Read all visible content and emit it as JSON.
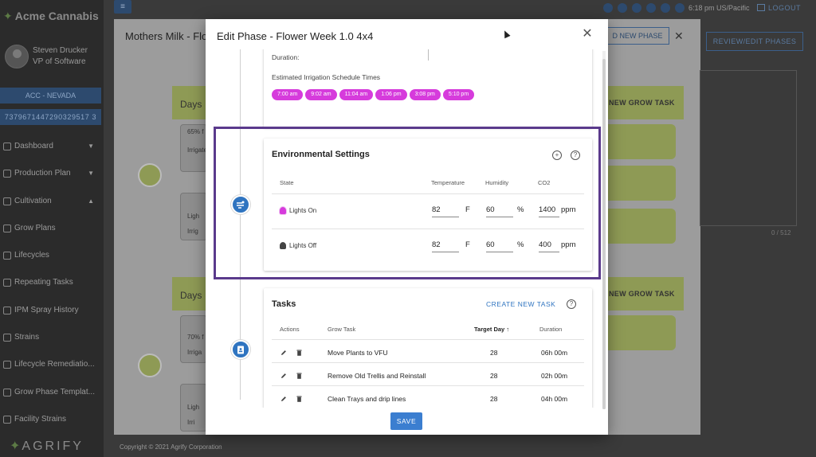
{
  "sidebar": {
    "brand": "Acme Cannabis",
    "user_name": "Steven Drucker",
    "user_role": "VP of Software",
    "facility": "ACC - NEVADA",
    "license": "7379671447290329517 3",
    "items": [
      {
        "label": "Dashboard",
        "icon": "dashboard-icon",
        "caret": "▼"
      },
      {
        "label": "Production Plan",
        "icon": "pie-icon",
        "caret": "▼"
      },
      {
        "label": "Cultivation",
        "icon": "cultivation-icon",
        "caret": "▲"
      },
      {
        "label": "Grow Plans",
        "icon": "chart-icon",
        "caret": ""
      },
      {
        "label": "Lifecycles",
        "icon": "dots-icon",
        "caret": ""
      },
      {
        "label": "Repeating Tasks",
        "icon": "clock-icon",
        "caret": ""
      },
      {
        "label": "IPM Spray History",
        "icon": "history-icon",
        "caret": ""
      },
      {
        "label": "Strains",
        "icon": "smile-icon",
        "caret": ""
      },
      {
        "label": "Lifecycle Remediatio...",
        "icon": "remediation-icon",
        "caret": ""
      },
      {
        "label": "Grow Phase Templat...",
        "icon": "template-icon",
        "caret": ""
      },
      {
        "label": "Facility Strains",
        "icon": "cart-icon",
        "caret": ""
      }
    ],
    "footer_brand": "AGRIFY"
  },
  "topbar": {
    "time": "6:18 pm US/Pacific",
    "logout": "LOGOUT"
  },
  "background": {
    "title": "Mothers Milk - Flo",
    "add_phase": "D NEW PHASE",
    "review": "REVIEW/EDIT PHASES",
    "char_count": "0 / 512",
    "days_label": "Days",
    "grow_task": "NEW GROW TASK",
    "card1_text": "65% f",
    "card1_sub": "Irrigate",
    "card2_text": "Ligh",
    "card2_sub": "Irrig",
    "card3_text": "70% f",
    "card3_sub": "Irriga",
    "card4_text": "Ligh",
    "card4_sub": "Irri",
    "copyright": "Copyright © 2021 Agrify Corporation"
  },
  "modal": {
    "title": "Edit Phase - Flower Week 1.0 4x4",
    "duration_label": "Duration:",
    "irrigation_label": "Estimated Irrigation Schedule Times",
    "irrigation_times": [
      "7:00 am",
      "9:02 am",
      "11:04 am",
      "1:06 pm",
      "3:08 pm",
      "5:10 pm"
    ],
    "env": {
      "title": "Environmental Settings",
      "headers": {
        "state": "State",
        "temperature": "Temperature",
        "humidity": "Humidity",
        "co2": "CO2"
      },
      "rows": [
        {
          "state": "Lights On",
          "temp": "82",
          "temp_unit": "F",
          "humidity": "60",
          "humidity_unit": "%",
          "co2": "1400",
          "co2_unit": "ppm"
        },
        {
          "state": "Lights Off",
          "temp": "82",
          "temp_unit": "F",
          "humidity": "60",
          "humidity_unit": "%",
          "co2": "400",
          "co2_unit": "ppm"
        }
      ]
    },
    "tasks": {
      "title": "Tasks",
      "create": "CREATE NEW TASK",
      "headers": {
        "actions": "Actions",
        "task": "Grow Task",
        "day": "Target Day",
        "sort": "↑",
        "duration": "Duration"
      },
      "rows": [
        {
          "task": "Move Plants to VFU",
          "day": "28",
          "duration": "06h 00m"
        },
        {
          "task": "Remove Old Trellis and Reinstall",
          "day": "28",
          "duration": "02h 00m"
        },
        {
          "task": "Clean Trays and drip lines",
          "day": "28",
          "duration": "04h 00m"
        }
      ]
    },
    "save": "SAVE"
  },
  "colors": {
    "accent": "#2f74c0",
    "chip": "#d63bdc",
    "highlight": "#5a3a8c"
  }
}
